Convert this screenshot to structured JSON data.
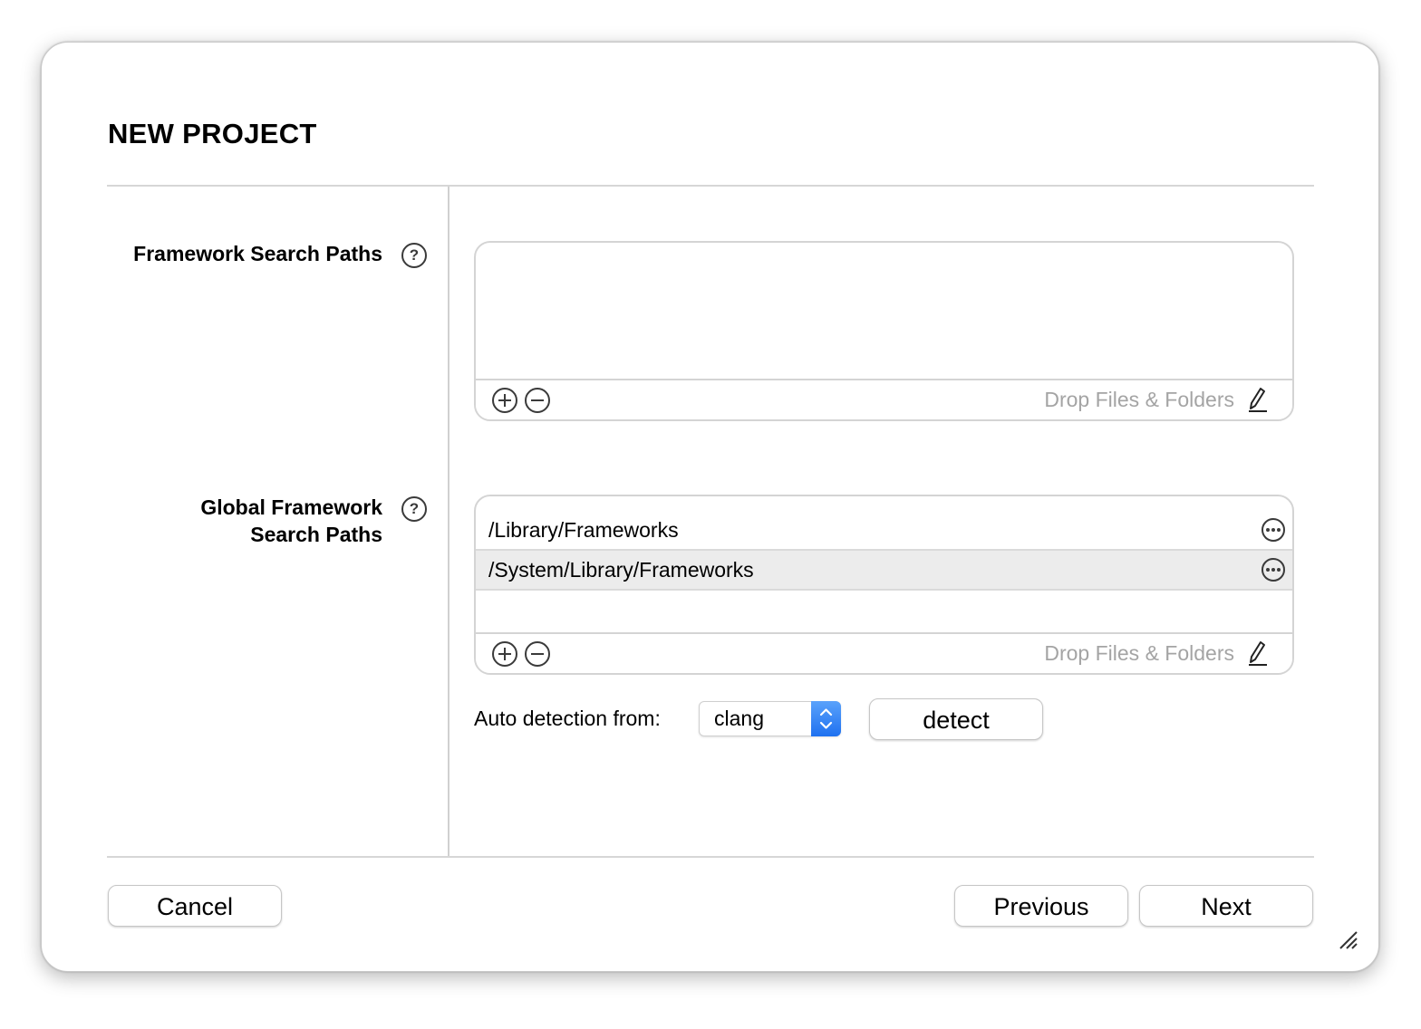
{
  "window": {
    "title": "NEW PROJECT"
  },
  "framework_search_paths": {
    "label": "Framework Search Paths",
    "help_icon": "?",
    "items": [],
    "drop_hint": "Drop Files & Folders"
  },
  "global_framework_search_paths": {
    "label_line1": "Global Framework",
    "label_line2": "Search Paths",
    "help_icon": "?",
    "items": [
      {
        "path": "/Library/Frameworks",
        "selected": false
      },
      {
        "path": "/System/Library/Frameworks",
        "selected": true
      }
    ],
    "drop_hint": "Drop Files & Folders"
  },
  "auto_detection": {
    "label": "Auto detection from:",
    "selected_option": "clang",
    "detect_button": "detect"
  },
  "footer": {
    "cancel_label": "Cancel",
    "previous_label": "Previous",
    "next_label": "Next"
  },
  "colors": {
    "accent": "#2b7cf6",
    "selected_row": "#ececec",
    "hint_text": "#a4a4a4",
    "divider": "#d6d6d6"
  },
  "icons": [
    "help-icon",
    "add-icon",
    "remove-icon",
    "pencil-icon",
    "more-icon",
    "stepper-arrows-icon",
    "resize-grip-icon"
  ]
}
